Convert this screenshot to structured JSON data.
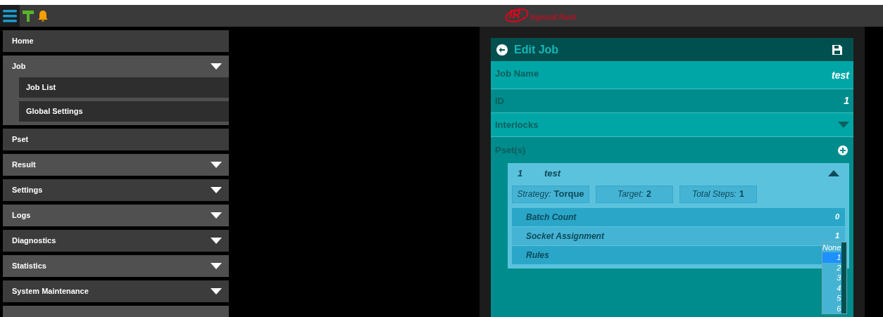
{
  "header": {
    "logo_mark": "IR",
    "brand": "Ingersoll Rand"
  },
  "sidebar": {
    "items": [
      {
        "label": "Home",
        "expandable": false
      },
      {
        "label": "Job",
        "expandable": true,
        "expanded": true,
        "children": [
          {
            "label": "Job List"
          },
          {
            "label": "Global Settings"
          }
        ]
      },
      {
        "label": "Pset",
        "expandable": false
      },
      {
        "label": "Result",
        "expandable": true,
        "expanded": false
      },
      {
        "label": "Settings",
        "expandable": true,
        "expanded": false
      },
      {
        "label": "Logs",
        "expandable": true,
        "expanded": false
      },
      {
        "label": "Diagnostics",
        "expandable": true,
        "expanded": false
      },
      {
        "label": "Statistics",
        "expandable": true,
        "expanded": false
      },
      {
        "label": "System Maintenance",
        "expandable": true,
        "expanded": false
      },
      {
        "expandable": false
      }
    ]
  },
  "editor": {
    "title": "Edit Job",
    "fields": [
      {
        "label": "Job Name",
        "value": "test",
        "kind": "text"
      },
      {
        "label": "ID",
        "value": "1",
        "kind": "text"
      },
      {
        "label": "Interlocks",
        "kind": "collapsible",
        "expanded": false
      }
    ],
    "psets_label": "Pset(s)",
    "pset": {
      "number": "1",
      "name": "test",
      "expanded": true,
      "chips": [
        {
          "label": "Strategy:",
          "value": "Torque"
        },
        {
          "label": "Target:",
          "value": "2"
        },
        {
          "label": "Total Steps:",
          "value": "1"
        }
      ],
      "params": [
        {
          "label": "Batch Count",
          "value": "0"
        },
        {
          "label": "Socket Assignment",
          "value": "1"
        },
        {
          "label": "Rules"
        }
      ]
    },
    "dropdown": {
      "options": [
        {
          "label": "None",
          "selected": false
        },
        {
          "label": "1",
          "selected": true
        },
        {
          "label": "2",
          "selected": false
        },
        {
          "label": "3",
          "selected": false
        },
        {
          "label": "4",
          "selected": false
        },
        {
          "label": "5",
          "selected": false
        },
        {
          "label": "6",
          "selected": false
        }
      ]
    }
  }
}
